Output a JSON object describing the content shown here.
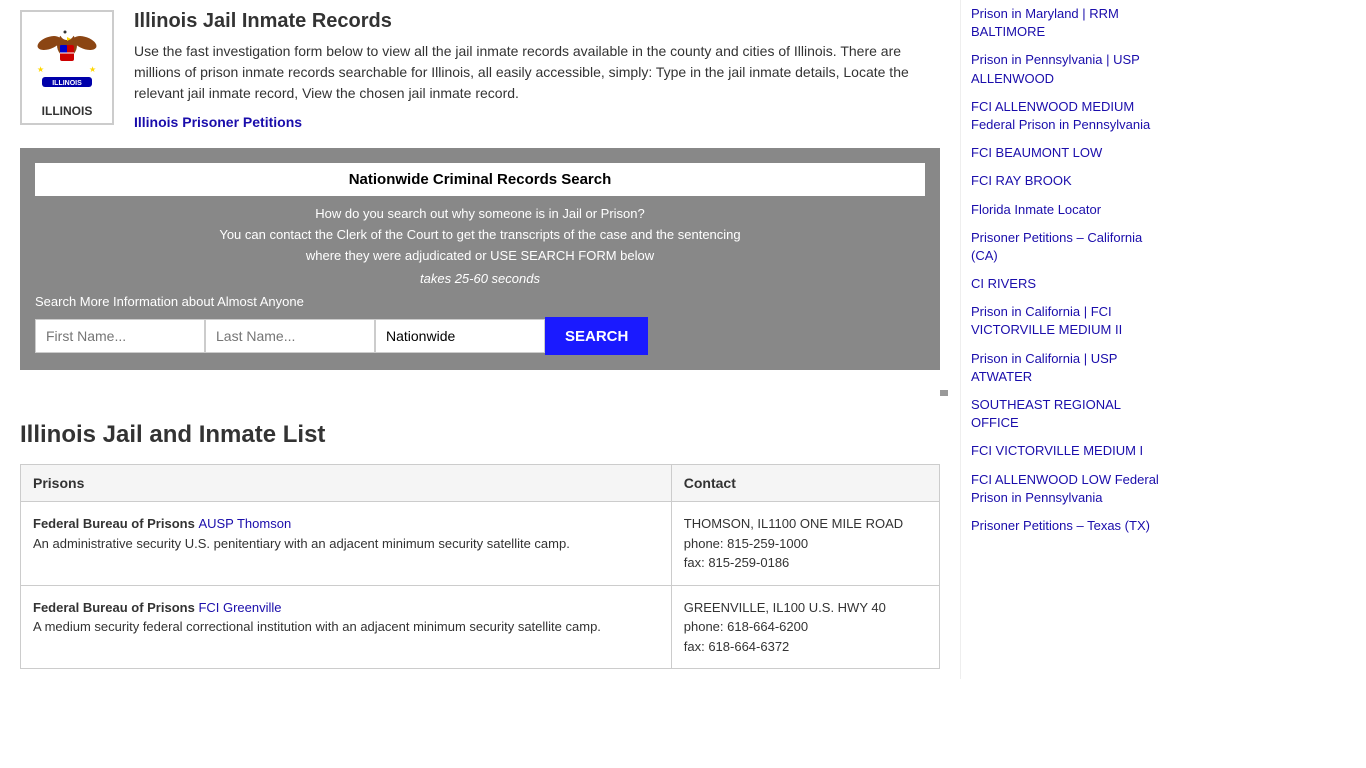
{
  "page": {
    "title": "Illinois Jail Inmate Records",
    "subtitle": "Illinois Jail and Inmate List"
  },
  "header": {
    "state_name": "ILLINOIS",
    "title": "Illinois Jail Inmate Records",
    "description": "Use the fast investigation form below to view all the jail inmate records available in the county and cities of Illinois. There are millions of prison inmate records searchable for Illinois, all easily accessible, simply: Type in the jail inmate details, Locate the relevant jail inmate record, View the chosen jail inmate record.",
    "link_text": "Illinois Prisoner Petitions"
  },
  "search": {
    "title": "Nationwide Criminal Records Search",
    "line1": "How do you search out why someone is in Jail or Prison?",
    "line2": "You can contact the Clerk of the Court to get the transcripts of the case and the sentencing",
    "line3": "where they were adjudicated or USE SEARCH FORM below",
    "timing": "takes 25-60 seconds",
    "more_info": "Search More Information about Almost Anyone",
    "first_name_placeholder": "First Name...",
    "last_name_placeholder": "Last Name...",
    "location_value": "Nationwide",
    "button_label": "SEARCH"
  },
  "table": {
    "col1_header": "Prisons",
    "col2_header": "Contact",
    "rows": [
      {
        "prefix": "Federal Bureau of Prisons",
        "link_text": "AUSP Thomson",
        "description": "An administrative security U.S. penitentiary with an adjacent minimum security satellite camp.",
        "location": "THOMSON, IL1100 ONE MILE ROAD",
        "phone": "phone: 815-259-1000",
        "fax": "fax: 815-259-0186"
      },
      {
        "prefix": "Federal Bureau of Prisons",
        "link_text": "FCI Greenville",
        "description": "A medium security federal correctional institution with an adjacent minimum security satellite camp.",
        "location": "GREENVILLE, IL100 U.S. HWY 40",
        "phone": "phone: 618-664-6200",
        "fax": "fax: 618-664-6372"
      }
    ]
  },
  "sidebar": {
    "links": [
      "Prison in Maryland | RRM BALTIMORE",
      "Prison in Pennsylvania | USP ALLENWOOD",
      "FCI ALLENWOOD MEDIUM Federal Prison in Pennsylvania",
      "FCI BEAUMONT LOW",
      "FCI RAY BROOK",
      "Florida Inmate Locator",
      "Prisoner Petitions – California (CA)",
      "CI RIVERS",
      "Prison in California | FCI VICTORVILLE MEDIUM II",
      "Prison in California | USP ATWATER",
      "SOUTHEAST REGIONAL OFFICE",
      "FCI VICTORVILLE MEDIUM I",
      "FCI ALLENWOOD LOW Federal Prison in Pennsylvania",
      "Prisoner Petitions – Texas (TX)"
    ]
  }
}
